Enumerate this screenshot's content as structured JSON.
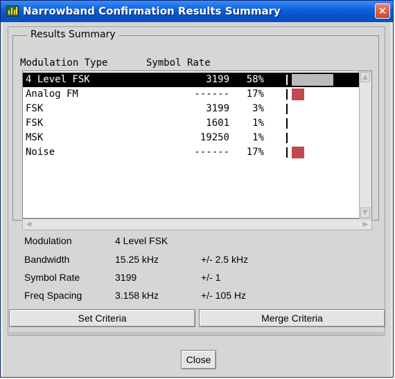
{
  "window": {
    "title": "Narrowband Confirmation Results Summary",
    "close_glyph": "✕"
  },
  "summary": {
    "group_label": "Results Summary",
    "columns": {
      "type": "Modulation Type",
      "rate": "Symbol Rate"
    },
    "rows": [
      {
        "type": "4 Level FSK",
        "rate": "3199",
        "pct": "58%",
        "fill": 0.58,
        "fill_color": "#b4b4b4",
        "selected": true
      },
      {
        "type": "Analog FM",
        "rate": "------",
        "pct": "17%",
        "fill": 0.17,
        "fill_color": "#b8393f",
        "selected": false
      },
      {
        "type": "FSK",
        "rate": "3199",
        "pct": "3%",
        "fill": 0.03,
        "fill_color": "#b8393f",
        "selected": false
      },
      {
        "type": "FSK",
        "rate": "1601",
        "pct": "1%",
        "fill": 0.01,
        "fill_color": "#b8393f",
        "selected": false
      },
      {
        "type": "MSK",
        "rate": "19250",
        "pct": "1%",
        "fill": 0.01,
        "fill_color": "#b8393f",
        "selected": false
      },
      {
        "type": "Noise",
        "rate": "------",
        "pct": "17%",
        "fill": 0.17,
        "fill_color": "#b8393f",
        "selected": false
      }
    ]
  },
  "details": {
    "modulation": {
      "label": "Modulation",
      "value": "4 Level FSK"
    },
    "bandwidth": {
      "label": "Bandwidth",
      "value": "15.25 kHz",
      "tol": "+/- 2.5 kHz"
    },
    "symbol_rate": {
      "label": "Symbol Rate",
      "value": "3199",
      "tol": "+/- 1"
    },
    "freq_spacing": {
      "label": "Freq Spacing",
      "value": "3.158 kHz",
      "tol": "+/- 105 Hz"
    }
  },
  "buttons": {
    "set_criteria": "Set Criteria",
    "merge_criteria": "Merge Criteria",
    "close": "Close"
  }
}
